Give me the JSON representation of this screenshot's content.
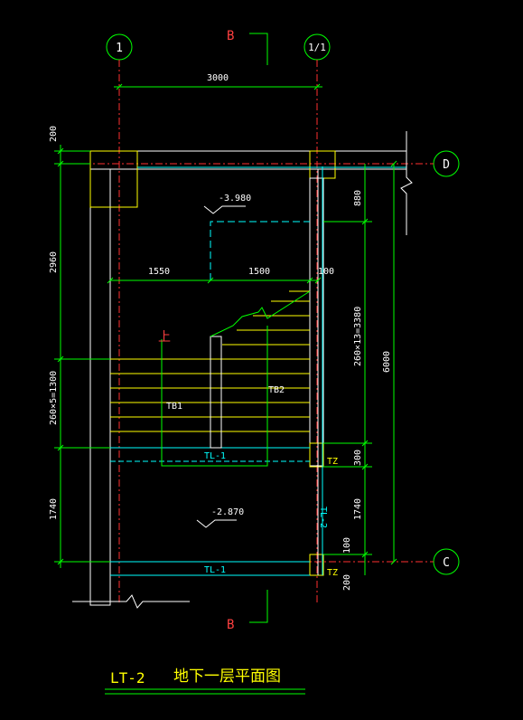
{
  "axes": {
    "left": "1",
    "right": "1/1",
    "top": "D",
    "bottom": "C"
  },
  "section_mark": "B",
  "dims": {
    "top_span": "3000",
    "left_200_top": "200",
    "left_2960": "2960",
    "left_flight": "260×5=1300",
    "left_1740": "1740",
    "run_1550": "1550",
    "run_1500": "1500",
    "run_100": "100",
    "right_880": "880",
    "right_flight": "260×13=3380",
    "right_6000": "6000",
    "right_300": "300",
    "right_1740": "1740",
    "right_100": "100",
    "right_200": "200"
  },
  "levels": {
    "upper": "-3.980",
    "lower": "-2.870"
  },
  "labels": {
    "up": "上",
    "tb1": "TB1",
    "tb2": "TB2",
    "tl1_mid": "TL-1",
    "tl1_bottom": "TL-1",
    "tl2": "TL-2",
    "tz_top": "TZ",
    "tz_bottom": "TZ"
  },
  "title": {
    "code": "LT-2",
    "name": "地下一层平面图"
  }
}
